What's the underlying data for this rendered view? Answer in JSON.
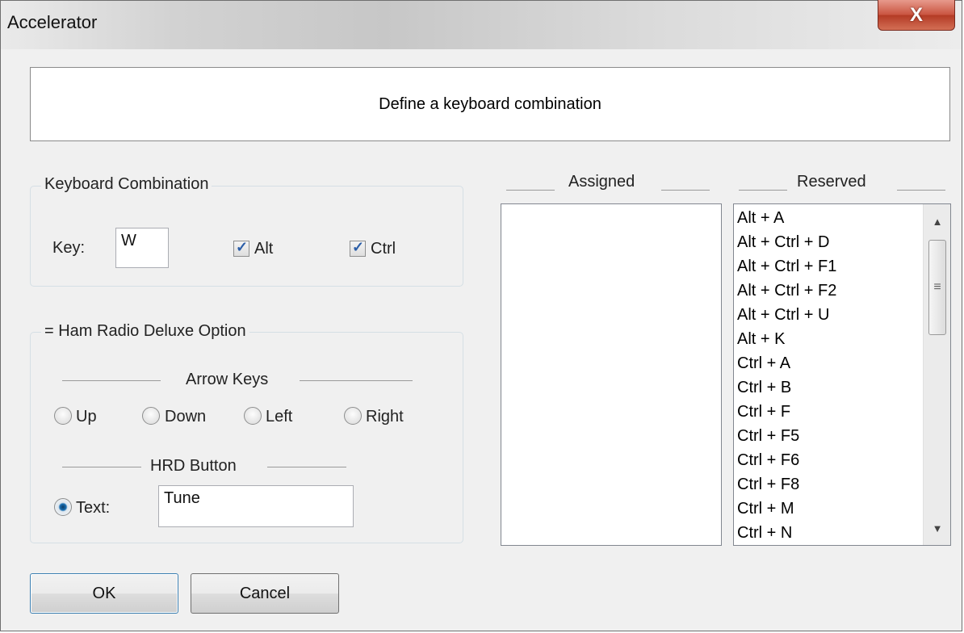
{
  "window": {
    "title": "Accelerator",
    "close_glyph": "X"
  },
  "header": {
    "text": "Define a keyboard combination"
  },
  "keyboard_combination": {
    "label": "Keyboard Combination",
    "key_label": "Key:",
    "key_value": "W",
    "alt_label": "Alt",
    "alt_checked": true,
    "ctrl_label": "Ctrl",
    "ctrl_checked": true
  },
  "hrd_option": {
    "label": "= Ham Radio Deluxe Option",
    "arrow_keys_label": "Arrow Keys",
    "arrow_keys": [
      {
        "label": "Up",
        "checked": false
      },
      {
        "label": "Down",
        "checked": false
      },
      {
        "label": "Left",
        "checked": false
      },
      {
        "label": "Right",
        "checked": false
      }
    ],
    "hrd_button_label": "HRD Button",
    "text_option": {
      "label": "Text:",
      "checked": true,
      "value": "Tune"
    }
  },
  "assigned": {
    "label": "Assigned",
    "items": []
  },
  "reserved": {
    "label": "Reserved",
    "items": [
      "Alt + A",
      "Alt + Ctrl + D",
      "Alt + Ctrl + F1",
      "Alt + Ctrl + F2",
      "Alt + Ctrl + U",
      "Alt + K",
      "Ctrl + A",
      "Ctrl + B",
      "Ctrl + F",
      "Ctrl + F5",
      "Ctrl + F6",
      "Ctrl + F8",
      "Ctrl + M",
      "Ctrl + N"
    ]
  },
  "buttons": {
    "ok": "OK",
    "cancel": "Cancel"
  },
  "icons": {
    "scroll_up": "scroll-up-arrow-icon",
    "scroll_down": "scroll-down-arrow-icon",
    "checkmark": "checkmark-icon"
  },
  "colors": {
    "close_button": "#c9533f",
    "checkmark": "#2b5ea8",
    "radio_selected": "#1a6fb3"
  }
}
